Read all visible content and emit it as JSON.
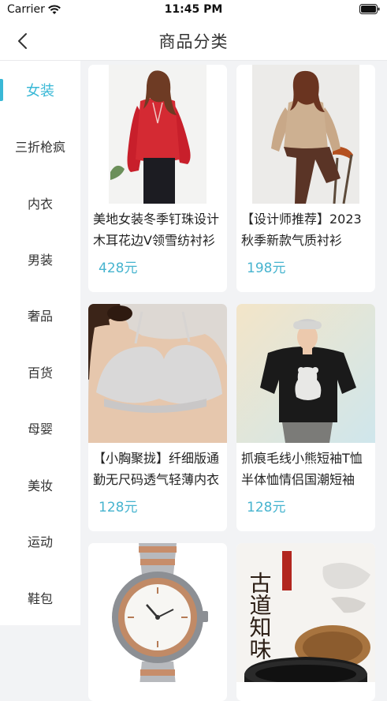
{
  "status": {
    "carrier": "Carrier",
    "time": "11:45 PM"
  },
  "nav": {
    "title": "商品分类"
  },
  "categories": [
    {
      "label": "女装",
      "active": true
    },
    {
      "label": "三折枪疯"
    },
    {
      "label": "内衣"
    },
    {
      "label": "男装"
    },
    {
      "label": "奢品"
    },
    {
      "label": "百货"
    },
    {
      "label": "母婴"
    },
    {
      "label": "美妆"
    },
    {
      "label": "运动"
    },
    {
      "label": "鞋包"
    }
  ],
  "products": [
    {
      "title": "美地女装冬季钉珠设计木耳花边V领雪纺衬衫",
      "price": "428元",
      "image": "woman-red-blouse"
    },
    {
      "title": "【设计师推荐】2023秋季新款气质衬衫",
      "price": "198元",
      "image": "woman-beige-shirt"
    },
    {
      "title": "【小胸聚拢】纤细版通勤无尺码透气轻薄内衣",
      "price": "128元",
      "image": "bra-model"
    },
    {
      "title": "抓痕毛线小熊短袖T恤半体恤情侣国潮短袖",
      "price": "128元",
      "image": "man-bear-tshirt"
    },
    {
      "title": "",
      "price": "",
      "image": "wristwatch"
    },
    {
      "title": "",
      "price": "",
      "image": "cast-iron-pot"
    }
  ],
  "product_image_text": {
    "ad_title": "古道知味"
  },
  "colors": {
    "accent": "#39b8d6",
    "price": "#47b4cf",
    "background": "#f2f3f5"
  }
}
